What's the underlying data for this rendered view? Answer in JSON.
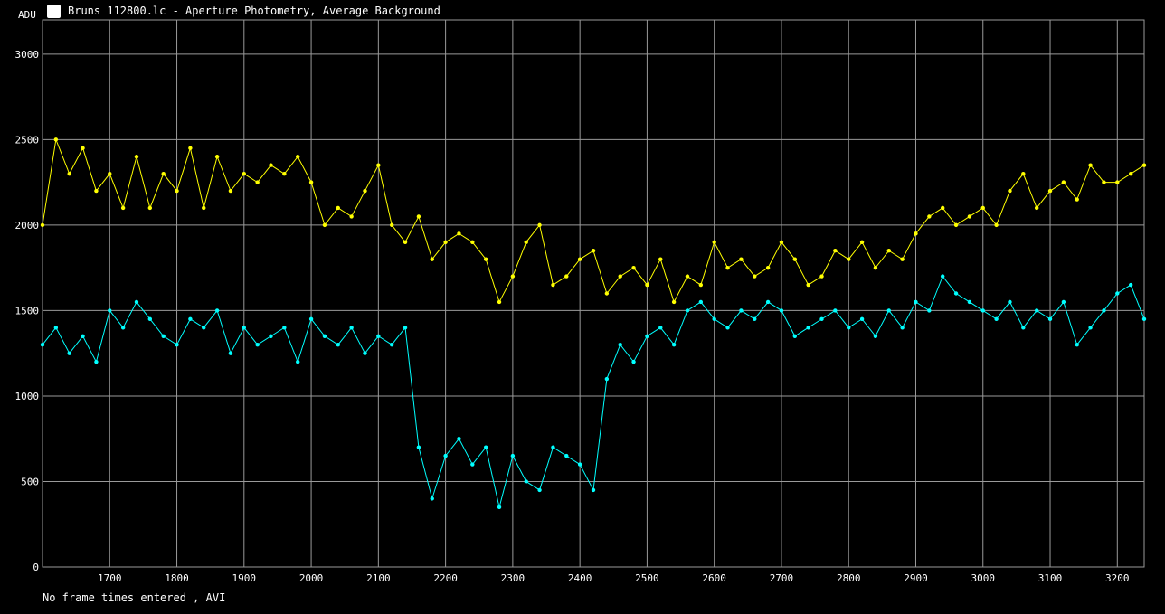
{
  "window": {
    "title": "Bruns 112800.lc - Aperture Photometry, Average Background",
    "icon": "photometry-app-icon"
  },
  "footer": {
    "status": "No frame times entered , AVI"
  },
  "colors": {
    "background": "#000000",
    "grid": "#9a9a9a",
    "series_yellow": "#ffff00",
    "series_cyan": "#00ffff"
  },
  "chart_data": {
    "type": "line",
    "title": "",
    "xlabel": "",
    "ylabel": "ADU",
    "xlim": [
      1600,
      3240
    ],
    "ylim": [
      0,
      3200
    ],
    "xticks": [
      1700,
      1800,
      1900,
      2000,
      2100,
      2200,
      2300,
      2400,
      2500,
      2600,
      2700,
      2800,
      2900,
      3000,
      3100,
      3200
    ],
    "yticks": [
      0,
      500,
      1000,
      1500,
      2000,
      2500,
      3000
    ],
    "grid": true,
    "legend": "none",
    "markers": true,
    "series": [
      {
        "color": "#ffff00",
        "x": [
          1600,
          1620,
          1640,
          1660,
          1680,
          1700,
          1720,
          1740,
          1760,
          1780,
          1800,
          1820,
          1840,
          1860,
          1880,
          1900,
          1920,
          1940,
          1960,
          1980,
          2000,
          2020,
          2040,
          2060,
          2080,
          2100,
          2120,
          2140,
          2160,
          2180,
          2200,
          2220,
          2240,
          2260,
          2280,
          2300,
          2320,
          2340,
          2360,
          2380,
          2400,
          2420,
          2440,
          2460,
          2480,
          2500,
          2520,
          2540,
          2560,
          2580,
          2600,
          2620,
          2640,
          2660,
          2680,
          2700,
          2720,
          2740,
          2760,
          2780,
          2800,
          2820,
          2840,
          2860,
          2880,
          2900,
          2920,
          2940,
          2960,
          2980,
          3000,
          3020,
          3040,
          3060,
          3080,
          3100,
          3120,
          3140,
          3160,
          3180,
          3200,
          3220,
          3240
        ],
        "values": [
          2000,
          2500,
          2300,
          2450,
          2200,
          2300,
          2100,
          2400,
          2100,
          2300,
          2200,
          2450,
          2100,
          2400,
          2200,
          2300,
          2250,
          2350,
          2300,
          2400,
          2250,
          2000,
          2100,
          2050,
          2200,
          2350,
          2000,
          1900,
          2050,
          1800,
          1900,
          1950,
          1900,
          1800,
          1550,
          1700,
          1900,
          2000,
          1650,
          1700,
          1800,
          1850,
          1600,
          1700,
          1750,
          1650,
          1800,
          1550,
          1700,
          1650,
          1900,
          1750,
          1800,
          1700,
          1750,
          1900,
          1800,
          1650,
          1700,
          1850,
          1800,
          1900,
          1750,
          1850,
          1800,
          1950,
          2050,
          2100,
          2000,
          2050,
          2100,
          2000,
          2200,
          2300,
          2100,
          2200,
          2250,
          2150,
          2350,
          2250,
          2250,
          2300,
          2350
        ]
      },
      {
        "color": "#00ffff",
        "x": [
          1600,
          1620,
          1640,
          1660,
          1680,
          1700,
          1720,
          1740,
          1760,
          1780,
          1800,
          1820,
          1840,
          1860,
          1880,
          1900,
          1920,
          1940,
          1960,
          1980,
          2000,
          2020,
          2040,
          2060,
          2080,
          2100,
          2120,
          2140,
          2160,
          2180,
          2200,
          2220,
          2240,
          2260,
          2280,
          2300,
          2320,
          2340,
          2360,
          2380,
          2400,
          2420,
          2440,
          2460,
          2480,
          2500,
          2520,
          2540,
          2560,
          2580,
          2600,
          2620,
          2640,
          2660,
          2680,
          2700,
          2720,
          2740,
          2760,
          2780,
          2800,
          2820,
          2840,
          2860,
          2880,
          2900,
          2920,
          2940,
          2960,
          2980,
          3000,
          3020,
          3040,
          3060,
          3080,
          3100,
          3120,
          3140,
          3160,
          3180,
          3200,
          3220,
          3240
        ],
        "values": [
          1300,
          1400,
          1250,
          1350,
          1200,
          1500,
          1400,
          1550,
          1450,
          1350,
          1300,
          1450,
          1400,
          1500,
          1250,
          1400,
          1300,
          1350,
          1400,
          1200,
          1450,
          1350,
          1300,
          1400,
          1250,
          1350,
          1300,
          1400,
          700,
          400,
          650,
          750,
          600,
          700,
          350,
          650,
          500,
          450,
          700,
          650,
          600,
          450,
          1100,
          1300,
          1200,
          1350,
          1400,
          1300,
          1500,
          1550,
          1450,
          1400,
          1500,
          1450,
          1550,
          1500,
          1350,
          1400,
          1450,
          1500,
          1400,
          1450,
          1350,
          1500,
          1400,
          1550,
          1500,
          1700,
          1600,
          1550,
          1500,
          1450,
          1550,
          1400,
          1500,
          1450,
          1550,
          1300,
          1400,
          1500,
          1600,
          1650,
          1450
        ]
      }
    ]
  }
}
